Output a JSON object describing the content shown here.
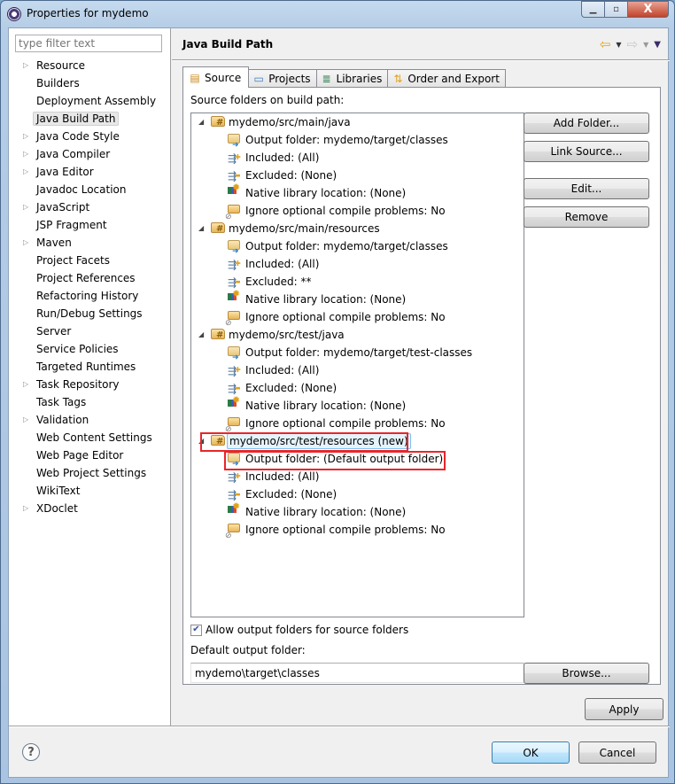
{
  "window": {
    "title": "Properties for mydemo",
    "controls": {
      "minimize": "▁",
      "maximize": "▫",
      "close": "X"
    }
  },
  "sidebar": {
    "filter_placeholder": "type filter text",
    "filter_value": "",
    "items": [
      {
        "label": "Resource",
        "expandable": true
      },
      {
        "label": "Builders",
        "expandable": false
      },
      {
        "label": "Deployment Assembly",
        "expandable": false
      },
      {
        "label": "Java Build Path",
        "expandable": false,
        "selected": true
      },
      {
        "label": "Java Code Style",
        "expandable": true
      },
      {
        "label": "Java Compiler",
        "expandable": true
      },
      {
        "label": "Java Editor",
        "expandable": true
      },
      {
        "label": "Javadoc Location",
        "expandable": false
      },
      {
        "label": "JavaScript",
        "expandable": true
      },
      {
        "label": "JSP Fragment",
        "expandable": false
      },
      {
        "label": "Maven",
        "expandable": true
      },
      {
        "label": "Project Facets",
        "expandable": false
      },
      {
        "label": "Project References",
        "expandable": false
      },
      {
        "label": "Refactoring History",
        "expandable": false
      },
      {
        "label": "Run/Debug Settings",
        "expandable": false
      },
      {
        "label": "Server",
        "expandable": false
      },
      {
        "label": "Service Policies",
        "expandable": false
      },
      {
        "label": "Targeted Runtimes",
        "expandable": false
      },
      {
        "label": "Task Repository",
        "expandable": true
      },
      {
        "label": "Task Tags",
        "expandable": false
      },
      {
        "label": "Validation",
        "expandable": true
      },
      {
        "label": "Web Content Settings",
        "expandable": false
      },
      {
        "label": "Web Page Editor",
        "expandable": false
      },
      {
        "label": "Web Project Settings",
        "expandable": false
      },
      {
        "label": "WikiText",
        "expandable": false
      },
      {
        "label": "XDoclet",
        "expandable": true
      }
    ]
  },
  "header": {
    "title": "Java Build Path",
    "back_icon": "⇦",
    "forward_icon": "⇨",
    "dropdown_icon": "▼"
  },
  "tabs": [
    {
      "label": "Source",
      "icon": "source-folder-icon",
      "active": true
    },
    {
      "label": "Projects",
      "icon": "projects-folder-icon",
      "active": false
    },
    {
      "label": "Libraries",
      "icon": "libraries-icon",
      "active": false
    },
    {
      "label": "Order and Export",
      "icon": "order-export-icon",
      "active": false
    }
  ],
  "source_tab": {
    "label": "Source folders on build path:",
    "tree": [
      {
        "label": "mydemo/src/main/java",
        "children": [
          {
            "icon": "output-folder-icon",
            "label": "Output folder: mydemo/target/classes"
          },
          {
            "icon": "included-icon",
            "label": "Included: (All)"
          },
          {
            "icon": "excluded-icon",
            "label": "Excluded: (None)"
          },
          {
            "icon": "native-library-icon",
            "label": "Native library location: (None)"
          },
          {
            "icon": "ignore-problems-icon",
            "label": "Ignore optional compile problems: No"
          }
        ]
      },
      {
        "label": "mydemo/src/main/resources",
        "children": [
          {
            "icon": "output-folder-icon",
            "label": "Output folder: mydemo/target/classes"
          },
          {
            "icon": "included-icon",
            "label": "Included: (All)"
          },
          {
            "icon": "excluded-icon",
            "label": "Excluded: **"
          },
          {
            "icon": "native-library-icon",
            "label": "Native library location: (None)"
          },
          {
            "icon": "ignore-problems-icon",
            "label": "Ignore optional compile problems: No"
          }
        ]
      },
      {
        "label": "mydemo/src/test/java",
        "children": [
          {
            "icon": "output-folder-icon",
            "label": "Output folder: mydemo/target/test-classes"
          },
          {
            "icon": "included-icon",
            "label": "Included: (All)"
          },
          {
            "icon": "excluded-icon",
            "label": "Excluded: (None)"
          },
          {
            "icon": "native-library-icon",
            "label": "Native library location: (None)"
          },
          {
            "icon": "ignore-problems-icon",
            "label": "Ignore optional compile problems: No"
          }
        ]
      },
      {
        "label": "mydemo/src/test/resources (new)",
        "selected": true,
        "children": [
          {
            "icon": "output-folder-icon",
            "label": "Output folder: (Default output folder)"
          },
          {
            "icon": "included-icon",
            "label": "Included: (All)"
          },
          {
            "icon": "excluded-icon",
            "label": "Excluded: (None)"
          },
          {
            "icon": "native-library-icon",
            "label": "Native library location: (None)"
          },
          {
            "icon": "ignore-problems-icon",
            "label": "Ignore optional compile problems: No"
          }
        ]
      }
    ],
    "buttons": {
      "add_folder": "Add Folder...",
      "link_source": "Link Source...",
      "edit": "Edit...",
      "remove": "Remove"
    },
    "allow_output_folders": {
      "label": "Allow output folders for source folders",
      "checked": true
    },
    "default_output_label": "Default output folder:",
    "default_output_value": "mydemo\\target\\classes",
    "browse": "Browse..."
  },
  "footer": {
    "apply": "Apply",
    "ok": "OK",
    "cancel": "Cancel",
    "help_icon": "?"
  },
  "colors": {
    "highlight_border": "#e8262a",
    "selection_bg": "#e5f3fb",
    "ok_button": "#bee6fd"
  }
}
